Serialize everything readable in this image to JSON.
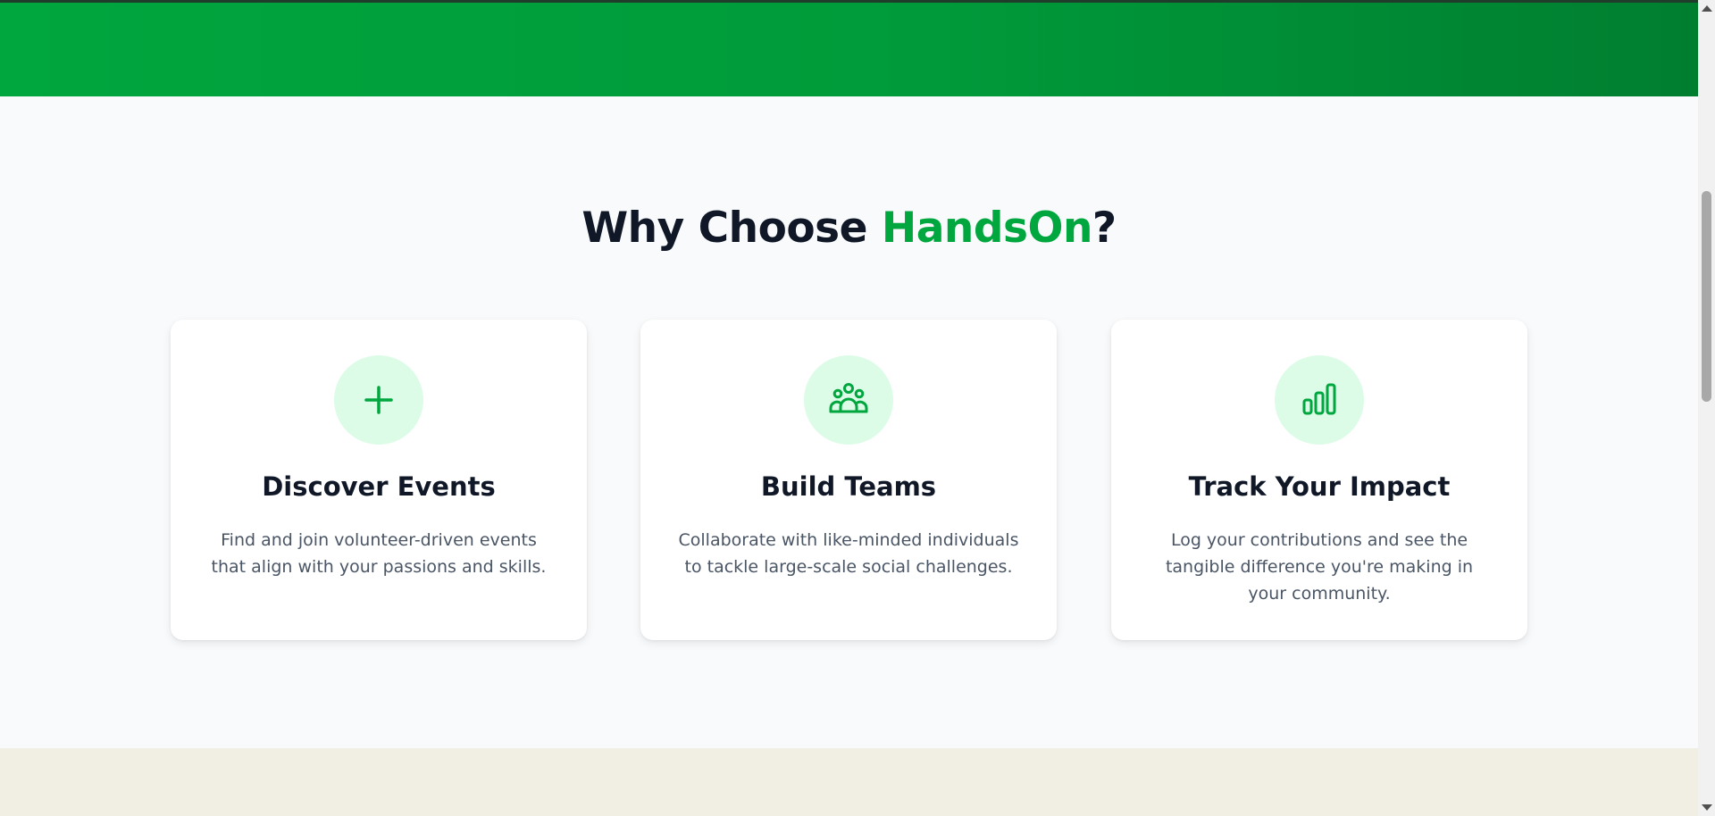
{
  "features": {
    "title_prefix": "Why Choose ",
    "title_brand": "HandsOn",
    "title_suffix": "?",
    "cards": [
      {
        "icon": "plus-icon",
        "title": "Discover Events",
        "description": "Find and join volunteer-driven events that align with your passions and skills."
      },
      {
        "icon": "users-group-icon",
        "title": "Build Teams",
        "description": "Collaborate with like-minded individuals to tackle large-scale social challenges."
      },
      {
        "icon": "bar-chart-icon",
        "title": "Track Your Impact",
        "description": "Log your contributions and see the tangible difference you're making in your community."
      }
    ]
  },
  "colors": {
    "brand_green": "#00a63e",
    "icon_bg": "#dcfce7",
    "heading": "#101828",
    "body_text": "#4a5565",
    "section_bg": "#f8fafc",
    "next_section_bg": "#f1eee3"
  }
}
